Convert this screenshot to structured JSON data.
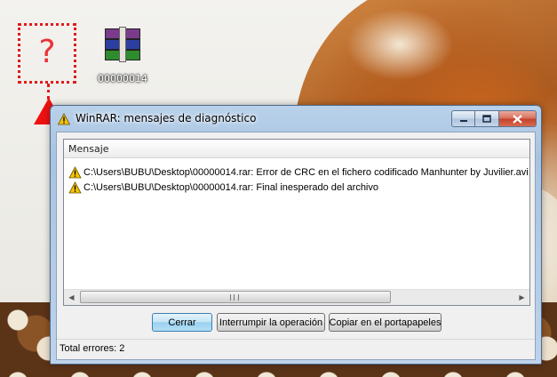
{
  "desktop": {
    "missing_icon_glyph": "?",
    "rar_icon_label": "00000014"
  },
  "window": {
    "title": "WinRAR: mensajes de diagnóstico",
    "list": {
      "column_header": "Mensaje",
      "messages": [
        {
          "icon": "warning-icon",
          "text": "C:\\Users\\BUBU\\Desktop\\00000014.rar: Error de CRC en el fichero codificado Manhunter by Juvilier.avi."
        },
        {
          "icon": "warning-icon",
          "text": "C:\\Users\\BUBU\\Desktop\\00000014.rar: Final inesperado del archivo"
        }
      ]
    },
    "buttons": {
      "close": "Cerrar",
      "abort": "Interrumpir la operación",
      "copy": "Copiar en el portapapeles"
    },
    "status": "Total errores: 2"
  },
  "colors": {
    "highlight_red": "#e21b1b",
    "title_bar": "#b9d1ea",
    "close_button": "#c4402a"
  }
}
